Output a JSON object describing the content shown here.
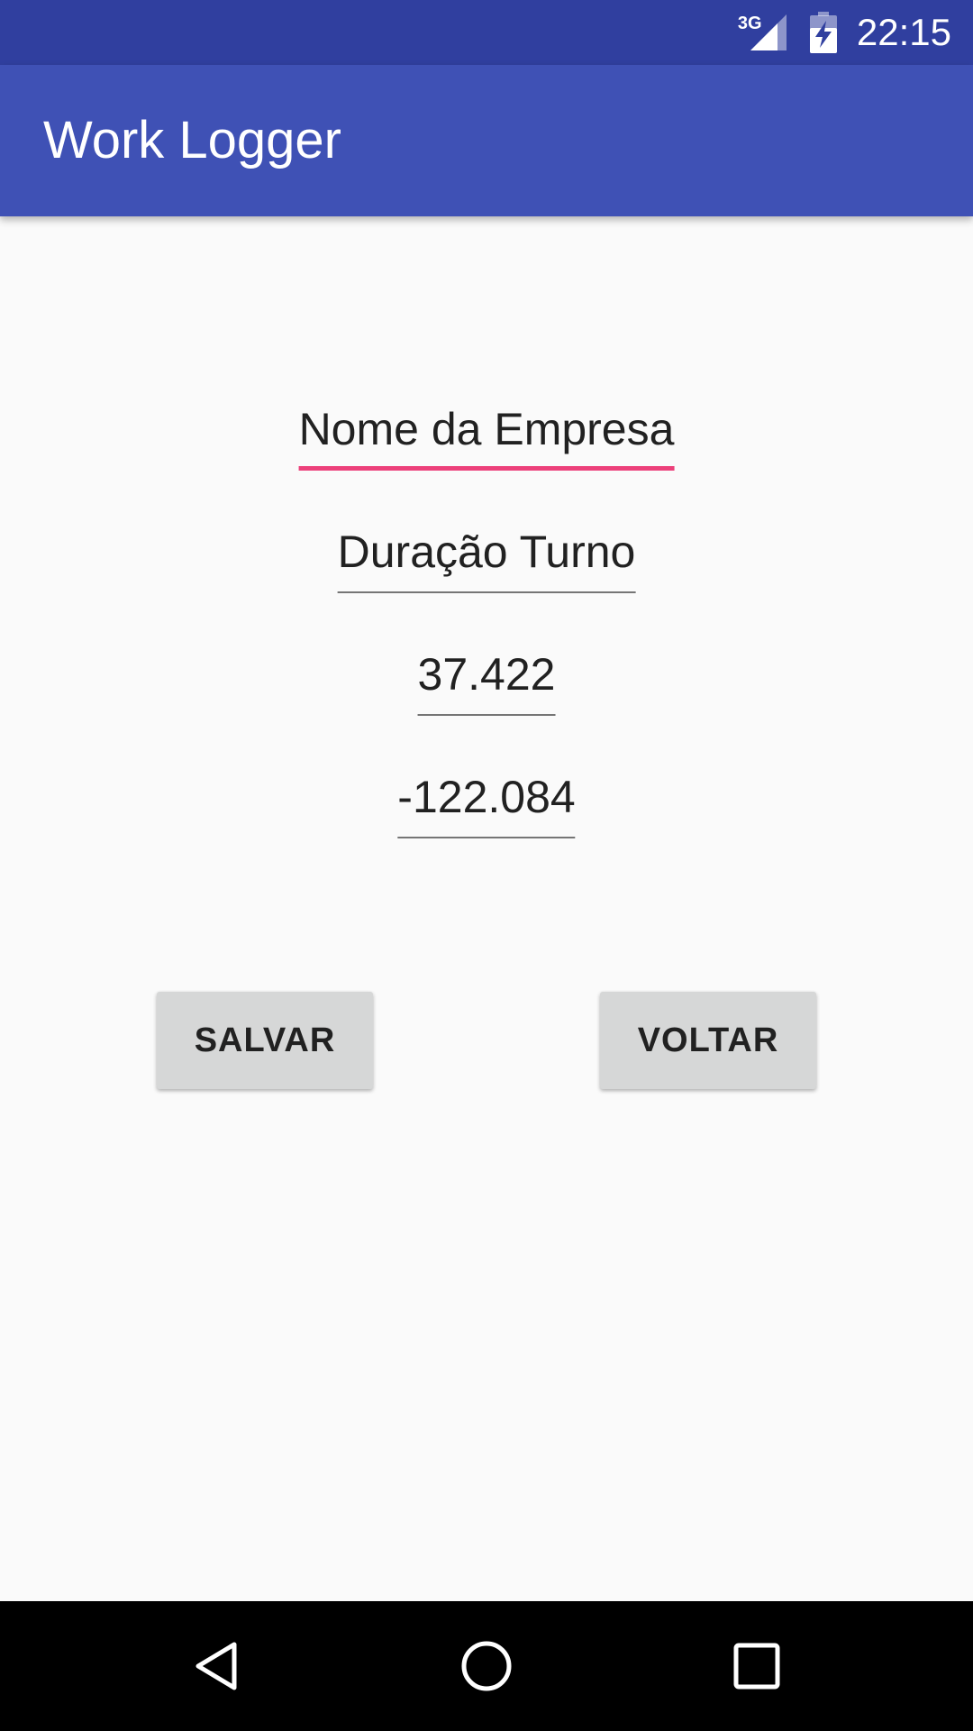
{
  "status_bar": {
    "network_type": "3G",
    "time": "22:15",
    "icons": [
      "signal-icon",
      "battery-charging-icon"
    ]
  },
  "app_bar": {
    "title": "Work Logger"
  },
  "form": {
    "company_name": "Nome da Empresa",
    "shift_duration": "Duração Turno",
    "latitude": "37.422",
    "longitude": "-122.084"
  },
  "buttons": {
    "save": "SALVAR",
    "back": "VOLTAR"
  },
  "nav_bar": {
    "icons": [
      "back-icon",
      "home-icon",
      "recents-icon"
    ]
  },
  "colors": {
    "status_bar": "#303f9f",
    "app_bar": "#3f51b5",
    "accent": "#ec407a",
    "background": "#fafafa",
    "button": "#d6d7d7"
  }
}
